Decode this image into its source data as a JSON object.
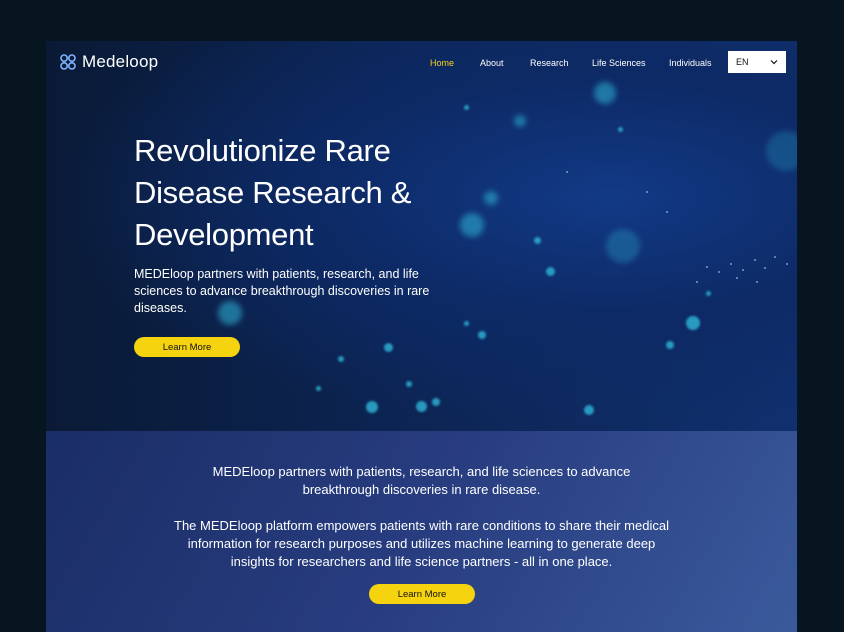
{
  "brand": {
    "name": "Medeloop",
    "logo_icon": "flower-logo-icon"
  },
  "nav": {
    "links": [
      {
        "label": "Home",
        "active": true
      },
      {
        "label": "About",
        "active": false
      },
      {
        "label": "Research",
        "active": false
      },
      {
        "label": "Life Sciences",
        "active": false
      },
      {
        "label": "Individuals",
        "active": false
      }
    ],
    "language": {
      "selected": "EN",
      "icon": "chevron-down-icon"
    }
  },
  "hero": {
    "headline_lines": [
      "Revolutionize Rare",
      "Disease Research &",
      "Development"
    ],
    "subcopy": "MEDEloop partners with patients, research, and life sciences to advance breakthrough discoveries in rare diseases.",
    "cta_label": "Learn More"
  },
  "info": {
    "paragraph1": "MEDEloop partners with patients, research, and life sciences to advance breakthrough discoveries in rare disease.",
    "paragraph2": "The MEDEloop platform empowers patients with rare conditions to share their medical information for research purposes and utilizes machine learning to generate deep insights for researchers and life science partners - all in one place.",
    "cta_label": "Learn More"
  },
  "colors": {
    "accent": "#f5d40f",
    "active_nav": "#f6d21b",
    "hero_bg": "#0c2452",
    "particle": "#2fb6d8",
    "info_bg": "#283d80"
  }
}
